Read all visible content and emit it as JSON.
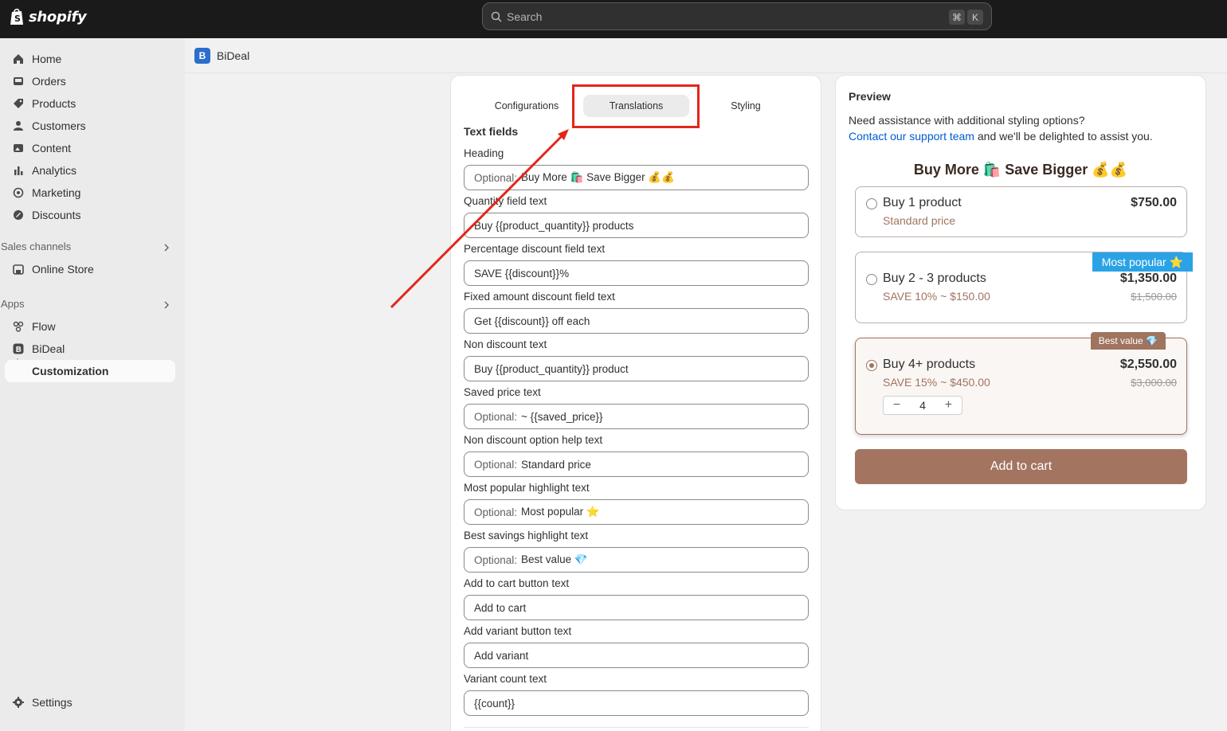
{
  "topbar": {
    "logo_text": "shopify",
    "search_placeholder": "Search",
    "kbd_cmd": "⌘",
    "kbd_k": "K"
  },
  "sidebar": {
    "items": [
      {
        "label": "Home",
        "icon": "home-icon"
      },
      {
        "label": "Orders",
        "icon": "inbox-icon"
      },
      {
        "label": "Products",
        "icon": "tag-icon"
      },
      {
        "label": "Customers",
        "icon": "person-icon"
      },
      {
        "label": "Content",
        "icon": "image-icon"
      },
      {
        "label": "Analytics",
        "icon": "bar-chart-icon"
      },
      {
        "label": "Marketing",
        "icon": "target-icon"
      },
      {
        "label": "Discounts",
        "icon": "discount-icon"
      }
    ],
    "sales_channels_label": "Sales channels",
    "online_store_label": "Online Store",
    "apps_label": "Apps",
    "flow_label": "Flow",
    "bideal_label": "BiDeal",
    "customization_label": "Customization",
    "settings_label": "Settings"
  },
  "app_header": {
    "logo_letter": "B",
    "name": "BiDeal"
  },
  "editor": {
    "tabs": [
      "Configurations",
      "Translations",
      "Styling"
    ],
    "active_tab": "Translations",
    "section_title": "Text fields",
    "fields": [
      {
        "label": "Heading",
        "prefix": "Optional:",
        "value": "Buy More 🛍️ Save Bigger 💰💰"
      },
      {
        "label": "Quantity field text",
        "prefix": "",
        "value": "Buy {{product_quantity}} products"
      },
      {
        "label": "Percentage discount field text",
        "prefix": "",
        "value": "SAVE {{discount}}%"
      },
      {
        "label": "Fixed amount discount field text",
        "prefix": "",
        "value": "Get {{discount}} off each"
      },
      {
        "label": "Non discount text",
        "prefix": "",
        "value": "Buy {{product_quantity}} product"
      },
      {
        "label": "Saved price text",
        "prefix": "Optional:",
        "value": " ~ {{saved_price}}"
      },
      {
        "label": "Non discount option help text",
        "prefix": "Optional:",
        "value": "Standard price"
      },
      {
        "label": "Most popular highlight text",
        "prefix": "Optional:",
        "value": "Most popular ⭐"
      },
      {
        "label": "Best savings highlight text",
        "prefix": "Optional:",
        "value": "Best value 💎"
      },
      {
        "label": "Add to cart button text",
        "prefix": "",
        "value": "Add to cart"
      },
      {
        "label": "Add variant button text",
        "prefix": "",
        "value": "Add variant"
      },
      {
        "label": "Variant count text",
        "prefix": "",
        "value": "{{count}}"
      }
    ]
  },
  "preview": {
    "title": "Preview",
    "help_line1": "Need assistance with additional styling options?",
    "help_link": "Contact our support team",
    "help_line2_rest": " and we'll be delighted to assist you.",
    "heading": "Buy More 🛍️ Save Bigger 💰💰",
    "options": [
      {
        "title": "Buy 1 product",
        "sub": "Standard price",
        "price": "$750.00",
        "strike": ""
      },
      {
        "title": "Buy 2 - 3 products",
        "sub": "SAVE 10% ~ $150.00",
        "price": "$1,350.00",
        "strike": "$1,500.00",
        "badge": "Most popular ⭐"
      },
      {
        "title": "Buy 4+ products",
        "sub": "SAVE 15% ~ $450.00",
        "price": "$2,550.00",
        "strike": "$3,000.00",
        "badge": "Best value 💎"
      }
    ],
    "stepper": {
      "minus": "−",
      "value": "4",
      "plus": "+"
    },
    "add_to_cart": "Add to cart",
    "accent_color": "#a37561",
    "badge_blue": "#2aa3e6"
  }
}
